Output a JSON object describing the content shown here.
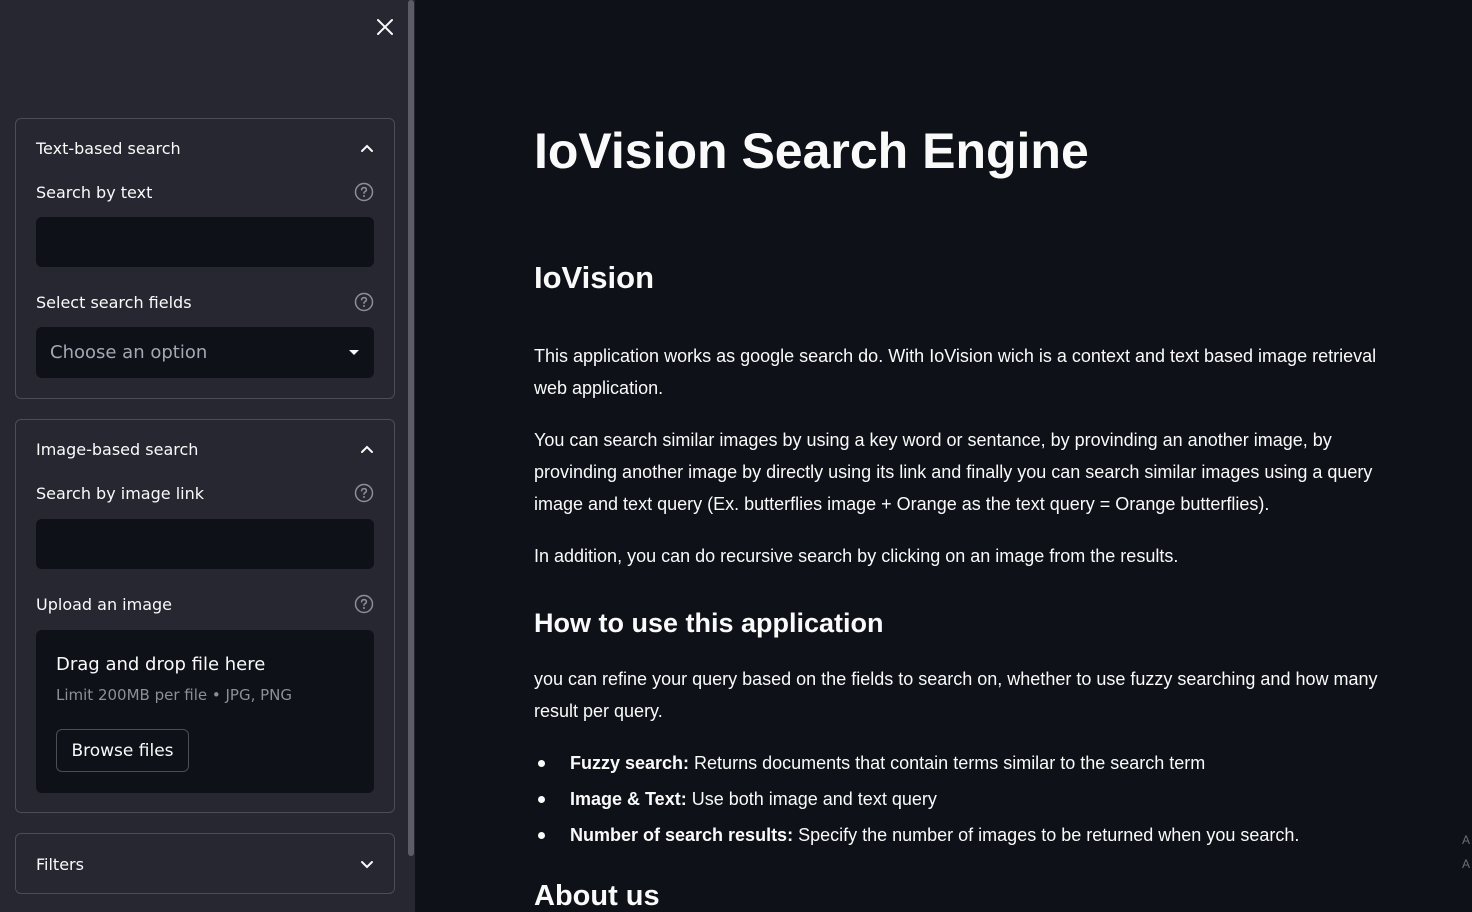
{
  "sidebar": {
    "close_icon": "close-icon",
    "text_search": {
      "header": "Text-based search",
      "search_label": "Search by text",
      "search_value": "",
      "fields_label": "Select search fields",
      "fields_placeholder": "Choose an option"
    },
    "image_search": {
      "header": "Image-based search",
      "link_label": "Search by image link",
      "link_value": "",
      "upload_label": "Upload an image",
      "dropzone_title": "Drag and drop file here",
      "dropzone_limit": "Limit 200MB per file • JPG, PNG",
      "browse_label": "Browse files"
    },
    "filters": {
      "header": "Filters"
    }
  },
  "main": {
    "title": "IoVision Search Engine",
    "section1_title": "IoVision",
    "intro_p1": "This application works as google search do. With IoVision wich is a context and text based image retrieval web application.",
    "intro_p2": "You can search similar images by using a key word or sentance, by provinding an another image, by provinding another image by directly using its link and finally you can search similar images using a query image and text query (Ex. butterflies image + Orange as the text query = Orange butterflies).",
    "intro_p3": "In addition, you can do recursive search by clicking on an image from the results.",
    "section2_title": "How to use this application",
    "howto_p": "you can refine your query based on the fields to search on, whether to use fuzzy searching and how many result per query.",
    "bullets": [
      {
        "term": "Fuzzy search:",
        "desc": " Returns documents that contain terms similar to the search term"
      },
      {
        "term": "Image & Text:",
        "desc": " Use both image and text query"
      },
      {
        "term": "Number of search results:",
        "desc": " Specify the number of images to be returned when you search."
      }
    ],
    "section3_title": "About us",
    "edge_marks": [
      "A",
      "A"
    ]
  },
  "colors": {
    "background": "#0e1117",
    "sidebar": "#262730",
    "border": "#4b4d57",
    "text": "#fafafa",
    "muted": "#a3a8b4"
  }
}
